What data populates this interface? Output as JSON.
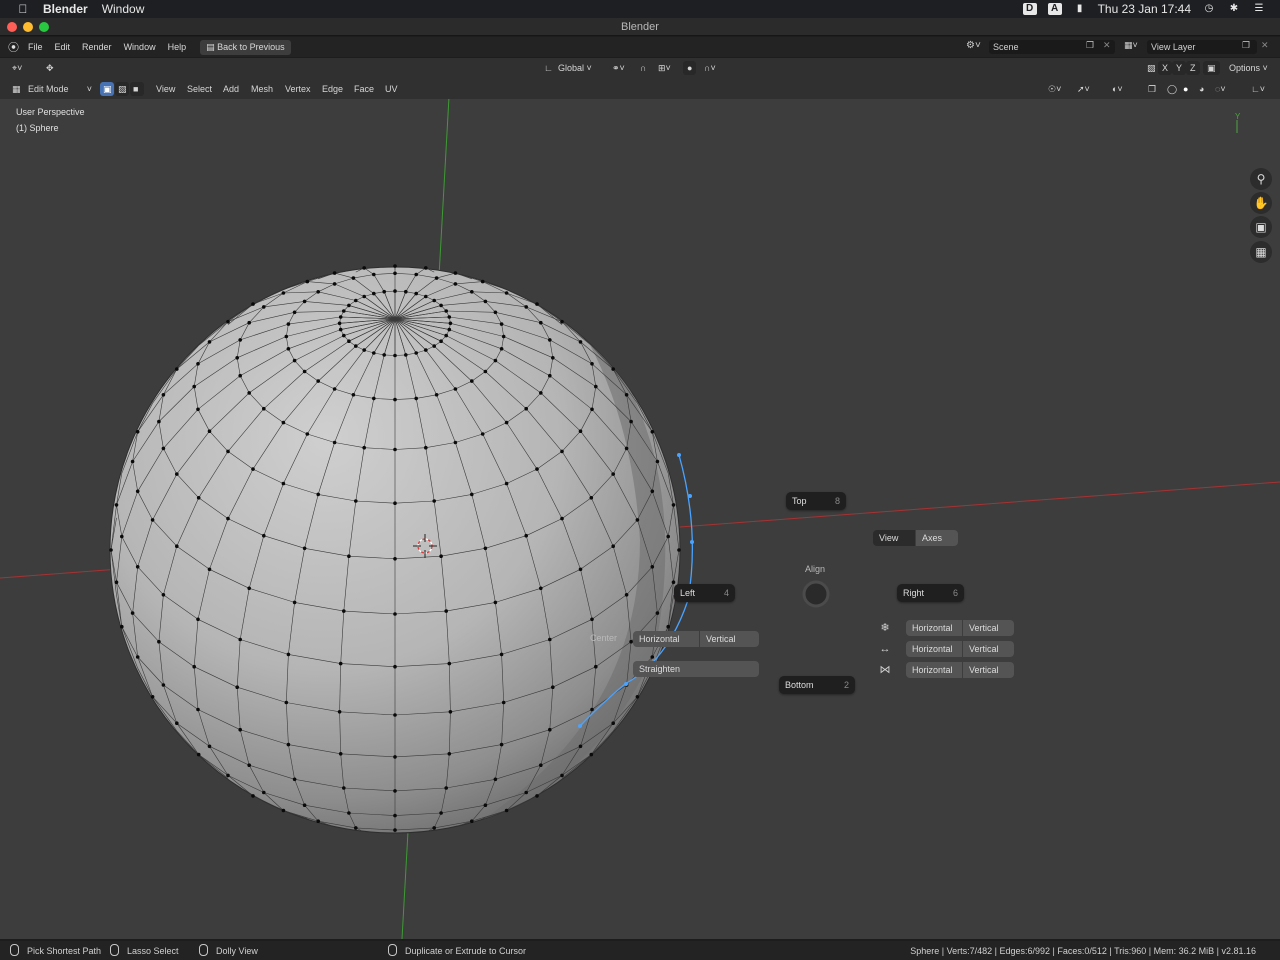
{
  "mac_menubar": {
    "app": "Blender",
    "menus": [
      "Window"
    ],
    "datetime": "Thu 23 Jan  17:44",
    "status_icons": [
      "dropbox-icon",
      "input-source-icon",
      "battery-icon",
      "time-machine-icon",
      "bluetooth-icon",
      "control-center-icon"
    ]
  },
  "window": {
    "title": "Blender"
  },
  "topbar": {
    "menus": [
      "File",
      "Edit",
      "Render",
      "Window",
      "Help"
    ],
    "back_button": "Back to Previous",
    "scene": "Scene",
    "view_layer": "View Layer"
  },
  "tool_header": {
    "orientation": "Global",
    "axes": [
      "X",
      "Y",
      "Z"
    ],
    "options": "Options"
  },
  "edit_header": {
    "mode": "Edit Mode",
    "menus": [
      "View",
      "Select",
      "Add",
      "Mesh",
      "Vertex",
      "Edge",
      "Face",
      "UV"
    ]
  },
  "viewport": {
    "perspective": "User Perspective",
    "object": "(1) Sphere",
    "nav_icons": [
      "zoom-icon",
      "pan-hand-icon",
      "camera-icon",
      "grid-icon"
    ]
  },
  "pie_menu": {
    "title": "Align",
    "top": {
      "label": "Top",
      "key": "8"
    },
    "left": {
      "label": "Left",
      "key": "4"
    },
    "right": {
      "label": "Right",
      "key": "6"
    },
    "bottom": {
      "label": "Bottom",
      "key": "2"
    },
    "view_axes": {
      "view": "View",
      "axes": "Axes"
    },
    "center_label": "Center",
    "center": {
      "horizontal": "Horizontal",
      "vertical": "Vertical"
    },
    "straighten": "Straighten",
    "rows": [
      {
        "icon": "snowflake-icon",
        "horizontal": "Horizontal",
        "vertical": "Vertical"
      },
      {
        "icon": "arrows-horizontal-icon",
        "horizontal": "Horizontal",
        "vertical": "Vertical"
      },
      {
        "icon": "pivot-icon",
        "horizontal": "Horizontal",
        "vertical": "Vertical"
      }
    ]
  },
  "statusbar": {
    "hint1": "Pick Shortest Path",
    "hint2": "Lasso Select",
    "hint3": "Dolly View",
    "hint4": "Duplicate or Extrude to Cursor",
    "stats": "Sphere | Verts:7/482 | Edges:6/992 | Faces:0/512 | Tris:960 | Mem: 36.2 MiB | v2.81.16"
  },
  "colors": {
    "selection": "#4772b3",
    "x_axis": "#b03a3a",
    "y_axis": "#4fa342",
    "selected_vertex": "#4aa3ff"
  }
}
